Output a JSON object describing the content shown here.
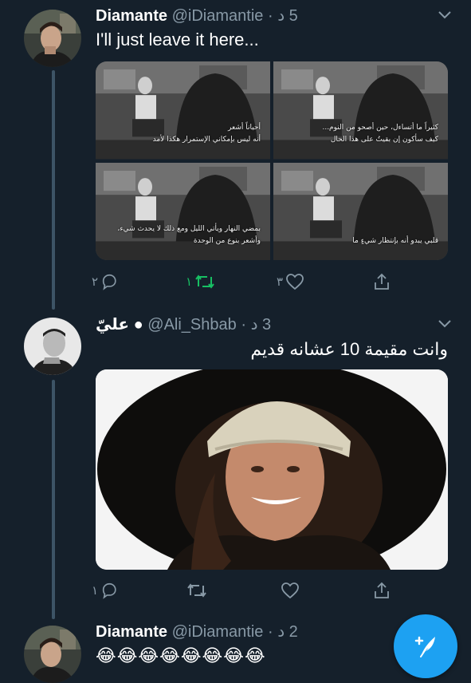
{
  "colors": {
    "background": "#15202b",
    "text": "#ffffff",
    "secondary_text": "#8899a6",
    "thread_line": "#3d5466",
    "retweet_green": "#17bf63",
    "accent_blue": "#1da1f2"
  },
  "tweets": [
    {
      "display_name": "Diamante",
      "handle": "@iDiamantie",
      "dot": "·",
      "time": "5 د",
      "text": "I'll just leave it here...",
      "media_captions": [
        [
          "أحياناً أشعر",
          "أنه ليس بإمكاني الإستمرار هكذا لأمد"
        ],
        [
          "كثيراً ما أتساءل، حين أصحو من النوم...",
          "كيف سأكون إن بقيتُ على هذا الحال"
        ],
        [
          "بمضي النهار ويأتي الليل ومع ذلك لا يحدث شيء،",
          "وأشعر بنوع من الوحدة"
        ],
        [
          "قلبي يبدو أنه بإنتظار شيءٍ ما"
        ]
      ],
      "actions": {
        "reply_count": "٢",
        "retweet_count": "١",
        "like_count": "٣",
        "retweet_icon": "retweet-icon-green",
        "reply_icon": "reply-icon",
        "like_icon": "heart-icon",
        "share_icon": "share-icon"
      }
    },
    {
      "display_name": "عليّ",
      "verified_marker": "●",
      "handle": "@Ali_Shbab",
      "dot": "·",
      "time": "3 د",
      "text": "وانت مقيمة 10 عشانه قديم",
      "actions": {
        "reply_count": "١",
        "reply_icon": "reply-icon",
        "retweet_icon": "retweet-icon",
        "like_icon": "heart-icon",
        "share_icon": "share-icon"
      }
    },
    {
      "display_name": "Diamante",
      "handle": "@iDiamantie",
      "dot": "·",
      "time": "2 د",
      "text": "😂😂😂😂😂😂😂😂"
    }
  ],
  "fab": {
    "icon": "compose-tweet-icon"
  }
}
